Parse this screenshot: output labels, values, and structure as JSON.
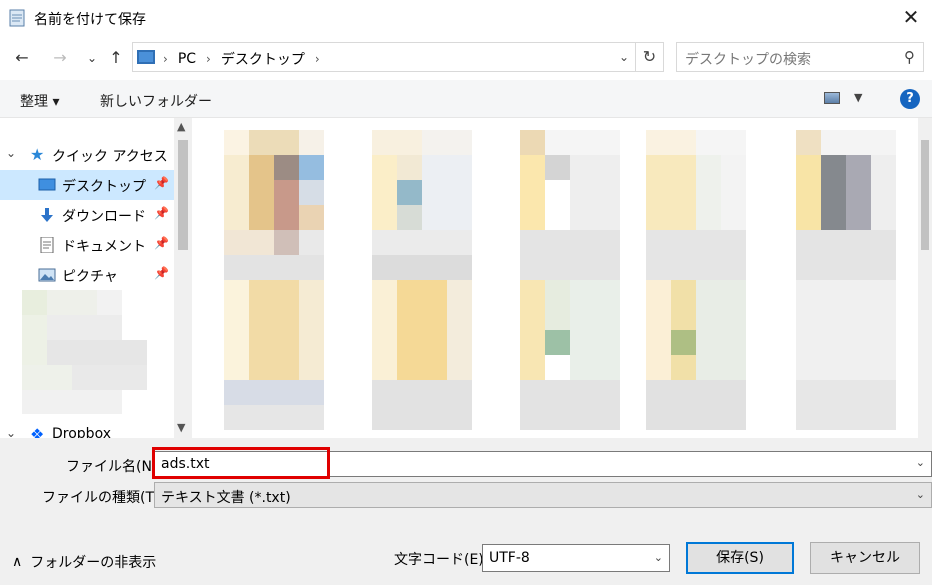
{
  "window": {
    "title": "名前を付けて保存",
    "close_glyph": "✕"
  },
  "nav": {
    "back_glyph": "←",
    "forward_glyph": "→",
    "recent_glyph": "⌄",
    "up_glyph": "↑",
    "address": {
      "crumbs": [
        "PC",
        "デスクトップ"
      ],
      "sep_glyph": "›",
      "dropdown_glyph": "⌄",
      "refresh_glyph": "↻"
    },
    "search": {
      "placeholder": "デスクトップの検索",
      "icon": "search-icon",
      "icon_glyph": "⚲"
    }
  },
  "toolbar": {
    "organize_label": "整理 ▾",
    "new_folder_label": "新しいフォルダー",
    "view_drop_glyph": "▼",
    "help_glyph": "?"
  },
  "sidebar": {
    "quick_access": {
      "label": "クイック アクセス",
      "chevron_glyph": "⌄",
      "icon_glyph": "★"
    },
    "items": [
      {
        "label": "デスクトップ",
        "icon": "desktop-icon",
        "selected": true
      },
      {
        "label": "ダウンロード",
        "icon": "download-icon",
        "selected": false
      },
      {
        "label": "ドキュメント",
        "icon": "document-icon",
        "selected": false
      },
      {
        "label": "ピクチャ",
        "icon": "pictures-icon",
        "selected": false
      }
    ],
    "pin_glyph": "📌",
    "dropbox": {
      "label": "Dropbox",
      "chevron_glyph": "⌄",
      "icon_glyph": "❖"
    },
    "scroll_up_glyph": "▲",
    "scroll_down_glyph": "▼"
  },
  "form": {
    "filename_label": "ファイル名(N):",
    "filename_value": "ads.txt",
    "filetype_label": "ファイルの種類(T):",
    "filetype_value": "テキスト文書 (*.txt)",
    "dropdown_glyph": "⌄"
  },
  "footer": {
    "hide_folders_label": "フォルダーの非表示",
    "hide_folders_glyph": "∧",
    "encoding_label": "文字コード(E):",
    "encoding_value": "UTF-8",
    "save_button": "保存(S)",
    "cancel_button": "キャンセル"
  },
  "colors": {
    "highlight_box": "#e00000",
    "selected_row": "#cce8ff",
    "primary_button_border": "#0078d7",
    "help_icon": "#1565c0"
  }
}
